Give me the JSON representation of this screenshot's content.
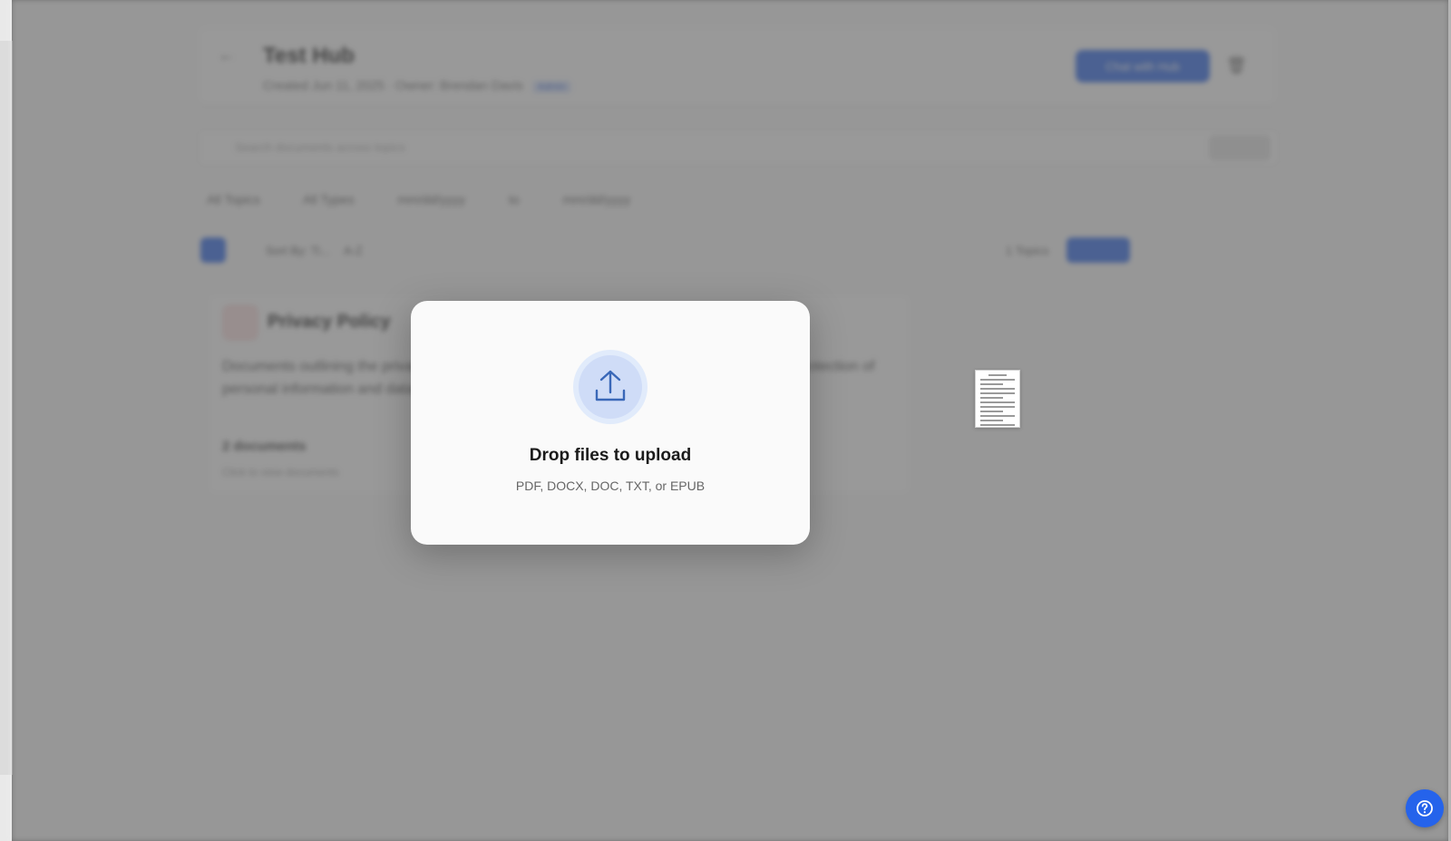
{
  "background": {
    "hub_title": "Test Hub",
    "hub_meta": "Created Jun 11, 2025 · Owner: Brendan Davis",
    "hub_badge": "Admin",
    "chat_button_label": "Chat with Hub",
    "search_placeholder": "Search documents across topics",
    "filters": [
      "All Topics",
      "All Types",
      "mm/dd/yyyy",
      "to",
      "mm/dd/yyyy"
    ],
    "sort_label": "Sort By: Ti...",
    "sort_order": "A-Z",
    "topic_count": "1 Topics",
    "update_button_label": "Update",
    "topic_card": {
      "title": "Privacy Policy",
      "description": "Documents outlining the privacy practices and commitments regarding the collection and protection of personal information and data.",
      "doc_count": "2 documents",
      "sub": "Click to view documents"
    }
  },
  "modal": {
    "icon": "upload-icon",
    "title": "Drop files to upload",
    "subtitle": "PDF, DOCX, DOC, TXT, or EPUB"
  },
  "help_button": {
    "icon": "help-icon"
  },
  "colors": {
    "accent": "#2563eb",
    "modal_bg": "#fafafa",
    "icon_halo": "#dbe6fa"
  }
}
